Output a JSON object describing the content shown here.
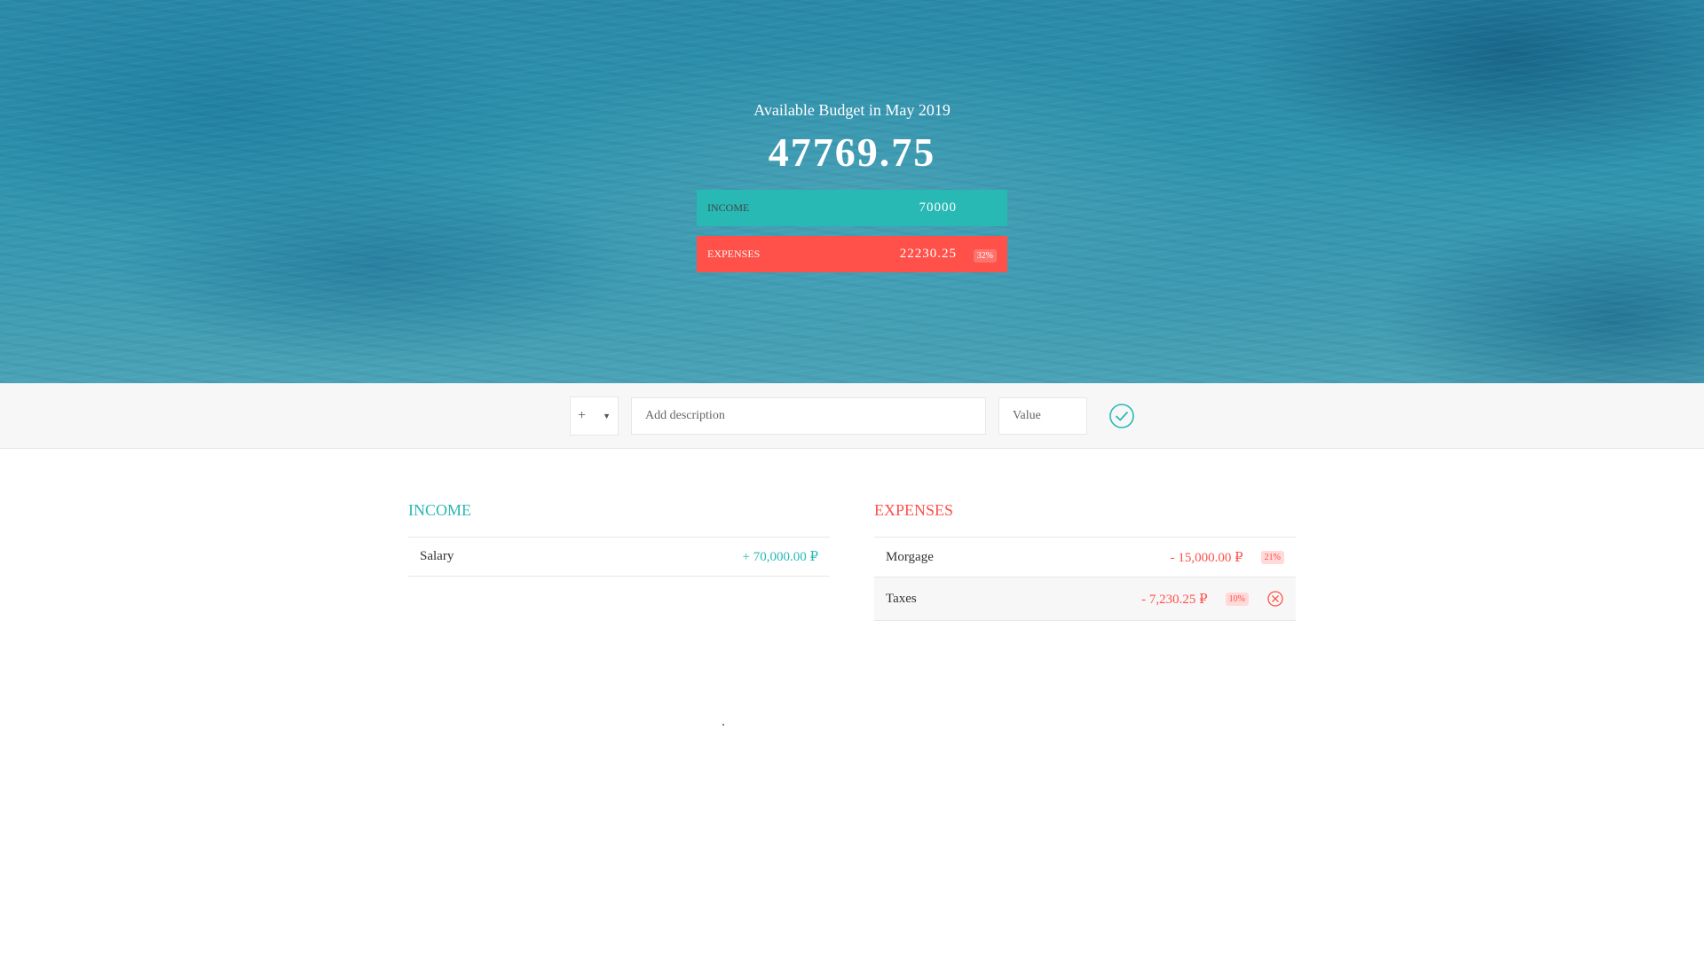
{
  "header": {
    "title": "Available Budget in May 2019",
    "value": "47769.75",
    "income": {
      "label": "Income",
      "value": "70000"
    },
    "expenses": {
      "label": "Expenses",
      "value": "22230.25",
      "percentage": "32%"
    }
  },
  "add": {
    "type_value": "+",
    "description_placeholder": "Add description",
    "value_placeholder": "Value"
  },
  "income": {
    "title": "Income",
    "items": [
      {
        "description": "Salary",
        "value": "+ 70,000.00 ₽"
      }
    ]
  },
  "expenses": {
    "title": "Expenses",
    "items": [
      {
        "description": "Morgage",
        "value": "- 15,000.00 ₽",
        "percentage": "21%"
      },
      {
        "description": "Taxes",
        "value": "- 7,230.25 ₽",
        "percentage": "10%"
      }
    ]
  },
  "colors": {
    "income": "#28b9b5",
    "expenses": "#ff5049"
  }
}
